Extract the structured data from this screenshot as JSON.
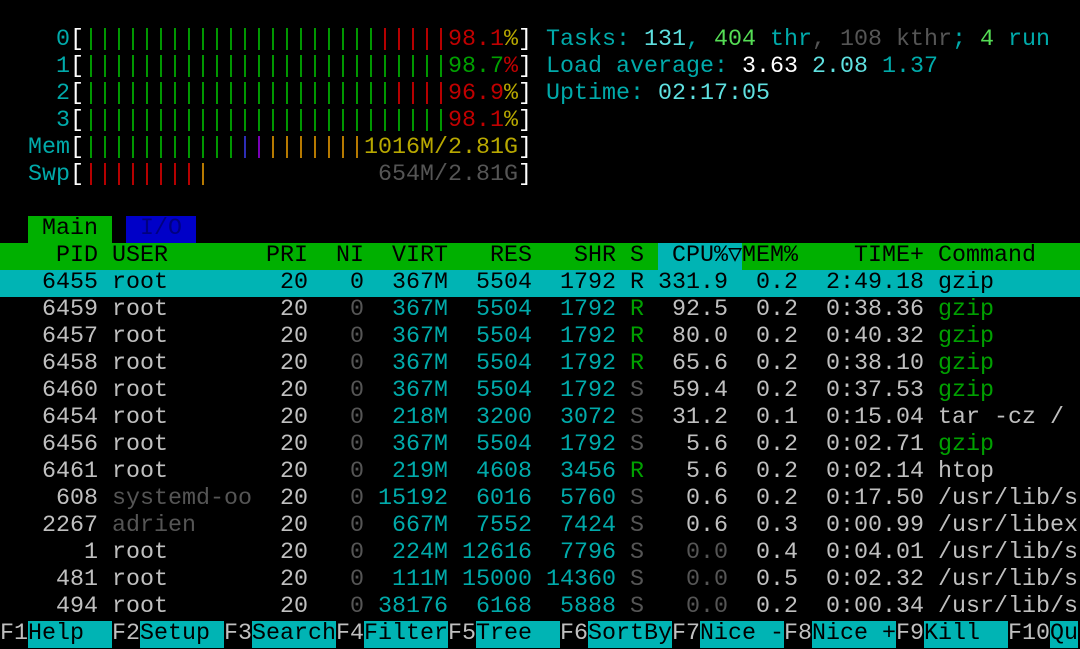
{
  "colors": {
    "default": "#c0c0c0",
    "cyan": "#00aaaa",
    "bright_cyan": "#5fe0e0",
    "green": "#00a000",
    "bright_green": "#55dd55",
    "red": "#c00000",
    "yellow": "#b8a800",
    "orange": "#c08000",
    "blue": "#3030c0",
    "purple": "#8000c0",
    "dim": "#555555",
    "white": "#ffffff",
    "header_bg": "#00b000",
    "selection_bg": "#00b4b4",
    "tab_io_bg": "#0000c8",
    "tab_io_fg": "#000080"
  },
  "meters": [
    {
      "label": "0",
      "segments": [
        {
          "text": "|||||||||||||||||||||",
          "color": "green"
        },
        {
          "text": "|||||",
          "color": "red"
        },
        {
          "text": "98.1",
          "color": "red"
        },
        {
          "text": "%",
          "color": "yellow"
        }
      ]
    },
    {
      "label": "1",
      "segments": [
        {
          "text": "||||||||||||||||||||||||||",
          "color": "green"
        },
        {
          "text": "98.7",
          "color": "green"
        },
        {
          "text": "%",
          "color": "red"
        }
      ]
    },
    {
      "label": "2",
      "segments": [
        {
          "text": "||||||||||||||||||||||",
          "color": "green"
        },
        {
          "text": "||||",
          "color": "red"
        },
        {
          "text": "96.9",
          "color": "red"
        },
        {
          "text": "%",
          "color": "yellow"
        }
      ]
    },
    {
      "label": "3",
      "segments": [
        {
          "text": "||||||||||||||||||||||||||",
          "color": "green"
        },
        {
          "text": "98.1",
          "color": "red"
        },
        {
          "text": "%",
          "color": "yellow"
        }
      ]
    },
    {
      "label": "Mem",
      "segments": [
        {
          "text": "|||||||||||",
          "color": "green"
        },
        {
          "text": "|",
          "color": "blue"
        },
        {
          "text": "|",
          "color": "purple"
        },
        {
          "text": "|||||||",
          "color": "orange"
        },
        {
          "text": "1016M/2.81G",
          "color": "yellow"
        }
      ]
    },
    {
      "label": "Swp",
      "segments": [
        {
          "text": "||||||||",
          "color": "red"
        },
        {
          "text": "|",
          "color": "orange"
        },
        {
          "text": "            ",
          "color": "dim"
        },
        {
          "text": "654M/2.81G",
          "color": "dim"
        }
      ]
    }
  ],
  "summary": [
    [
      {
        "text": "Tasks: ",
        "color": "cyan"
      },
      {
        "text": "131",
        "color": "bright_cyan"
      },
      {
        "text": ", ",
        "color": "cyan"
      },
      {
        "text": "404",
        "color": "bright_green"
      },
      {
        "text": " thr",
        "color": "cyan"
      },
      {
        "text": ", ",
        "color": "dim"
      },
      {
        "text": "108",
        "color": "dim"
      },
      {
        "text": " kthr",
        "color": "dim"
      },
      {
        "text": "; ",
        "color": "cyan"
      },
      {
        "text": "4",
        "color": "bright_green"
      },
      {
        "text": " run",
        "color": "cyan"
      }
    ],
    [
      {
        "text": "Load average: ",
        "color": "cyan"
      },
      {
        "text": "3.63 ",
        "color": "white"
      },
      {
        "text": "2.08 ",
        "color": "bright_cyan"
      },
      {
        "text": "1.37",
        "color": "cyan"
      }
    ],
    [
      {
        "text": "Uptime: ",
        "color": "cyan"
      },
      {
        "text": "02:17:05",
        "color": "bright_cyan"
      }
    ]
  ],
  "tabs": [
    {
      "label": "Main",
      "active": true
    },
    {
      "label": "I/O",
      "active": false
    }
  ],
  "columns": {
    "pid": "PID",
    "user": "USER",
    "pri": "PRI",
    "ni": "NI",
    "virt": "VIRT",
    "res": "RES",
    "shr": "SHR",
    "s": "S",
    "cpu": "CPU%",
    "sort_indicator": "▽",
    "mem": "MEM%",
    "time": "TIME+",
    "command": "Command"
  },
  "sorted_by": "cpu",
  "processes": [
    {
      "pid": "6455",
      "user": "root",
      "pri": "20",
      "ni": "0",
      "virt": "367M",
      "res": "5504",
      "shr": "1792",
      "s": "R",
      "cpu": "331.9",
      "mem": "0.2",
      "time": "2:49.18",
      "command": "gzip",
      "thread": false,
      "selected": true
    },
    {
      "pid": "6459",
      "user": "root",
      "pri": "20",
      "ni": "0",
      "virt": "367M",
      "res": "5504",
      "shr": "1792",
      "s": "R",
      "cpu": "92.5",
      "mem": "0.2",
      "time": "0:38.36",
      "command": "gzip",
      "thread": true
    },
    {
      "pid": "6457",
      "user": "root",
      "pri": "20",
      "ni": "0",
      "virt": "367M",
      "res": "5504",
      "shr": "1792",
      "s": "R",
      "cpu": "80.0",
      "mem": "0.2",
      "time": "0:40.32",
      "command": "gzip",
      "thread": true
    },
    {
      "pid": "6458",
      "user": "root",
      "pri": "20",
      "ni": "0",
      "virt": "367M",
      "res": "5504",
      "shr": "1792",
      "s": "R",
      "cpu": "65.6",
      "mem": "0.2",
      "time": "0:38.10",
      "command": "gzip",
      "thread": true
    },
    {
      "pid": "6460",
      "user": "root",
      "pri": "20",
      "ni": "0",
      "virt": "367M",
      "res": "5504",
      "shr": "1792",
      "s": "S",
      "cpu": "59.4",
      "mem": "0.2",
      "time": "0:37.53",
      "command": "gzip",
      "thread": true
    },
    {
      "pid": "6454",
      "user": "root",
      "pri": "20",
      "ni": "0",
      "virt": "218M",
      "res": "3200",
      "shr": "3072",
      "s": "S",
      "cpu": "31.2",
      "mem": "0.1",
      "time": "0:15.04",
      "command": "tar -cz /",
      "thread": false
    },
    {
      "pid": "6456",
      "user": "root",
      "pri": "20",
      "ni": "0",
      "virt": "367M",
      "res": "5504",
      "shr": "1792",
      "s": "S",
      "cpu": "5.6",
      "mem": "0.2",
      "time": "0:02.71",
      "command": "gzip",
      "thread": true
    },
    {
      "pid": "6461",
      "user": "root",
      "pri": "20",
      "ni": "0",
      "virt": "219M",
      "res": "4608",
      "shr": "3456",
      "s": "R",
      "cpu": "5.6",
      "mem": "0.2",
      "time": "0:02.14",
      "command": "htop",
      "thread": false
    },
    {
      "pid": "608",
      "user": "systemd-oo",
      "user_dim": true,
      "pri": "20",
      "ni": "0",
      "virt": "15192",
      "res": "6016",
      "shr": "5760",
      "s": "S",
      "cpu": "0.6",
      "mem": "0.2",
      "time": "0:17.50",
      "command": "/usr/lib/s",
      "thread": false
    },
    {
      "pid": "2267",
      "user": "adrien",
      "user_dim": true,
      "pri": "20",
      "ni": "0",
      "virt": "667M",
      "res": "7552",
      "shr": "7424",
      "s": "S",
      "cpu": "0.6",
      "mem": "0.3",
      "time": "0:00.99",
      "command": "/usr/libex",
      "thread": false
    },
    {
      "pid": "1",
      "user": "root",
      "pri": "20",
      "ni": "0",
      "virt": "224M",
      "res": "12616",
      "shr": "7796",
      "s": "S",
      "cpu": "0.0",
      "mem": "0.4",
      "time": "0:04.01",
      "command": "/usr/lib/s",
      "thread": false
    },
    {
      "pid": "481",
      "user": "root",
      "pri": "20",
      "ni": "0",
      "virt": "111M",
      "res": "15000",
      "shr": "14360",
      "s": "S",
      "cpu": "0.0",
      "mem": "0.5",
      "time": "0:02.32",
      "command": "/usr/lib/s",
      "thread": false
    },
    {
      "pid": "494",
      "user": "root",
      "pri": "20",
      "ni": "0",
      "virt": "38176",
      "res": "6168",
      "shr": "5888",
      "s": "S",
      "cpu": "0.0",
      "mem": "0.2",
      "time": "0:00.34",
      "command": "/usr/lib/s",
      "thread": false
    }
  ],
  "footer": [
    {
      "key": "F1",
      "label": "Help  "
    },
    {
      "key": "F2",
      "label": "Setup "
    },
    {
      "key": "F3",
      "label": "Search"
    },
    {
      "key": "F4",
      "label": "Filter"
    },
    {
      "key": "F5",
      "label": "Tree  "
    },
    {
      "key": "F6",
      "label": "SortBy"
    },
    {
      "key": "F7",
      "label": "Nice -"
    },
    {
      "key": "F8",
      "label": "Nice +"
    },
    {
      "key": "F9",
      "label": "Kill  "
    },
    {
      "key": "F10",
      "label": "Qu"
    }
  ]
}
